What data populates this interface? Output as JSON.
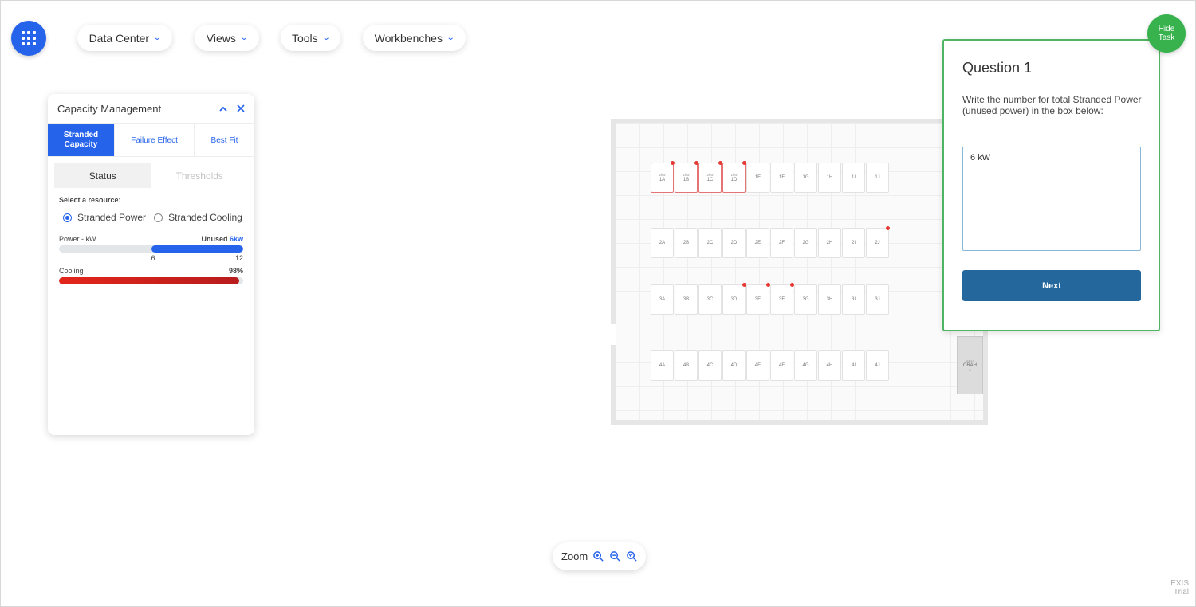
{
  "topbar": {
    "menus": [
      {
        "label": "Data Center"
      },
      {
        "label": "Views"
      },
      {
        "label": "Tools"
      },
      {
        "label": "Workbenches"
      }
    ]
  },
  "capacity_panel": {
    "title": "Capacity Management",
    "tabs": {
      "stranded_line1": "Stranded",
      "stranded_line2": "Capacity",
      "failure": "Failure Effect",
      "bestfit": "Best Fit"
    },
    "subtabs": {
      "status": "Status",
      "thresholds": "Thresholds"
    },
    "resource_label": "Select a resource:",
    "resources": {
      "power": "Stranded Power",
      "cooling": "Stranded Cooling"
    },
    "selected_resource": "Stranded Power",
    "power": {
      "label": "Power - kW",
      "unused_label": "Unused",
      "unused_value": "6kw",
      "tick_min": "6",
      "tick_max": "12",
      "used_kw": 6,
      "total_kw": 12
    },
    "cooling": {
      "label": "Cooling",
      "percent_label": "98%",
      "percent": 98
    }
  },
  "floor": {
    "racks": [
      {
        "id": "1A",
        "kw": "2kw",
        "alarm": true,
        "dot": true
      },
      {
        "id": "1B",
        "kw": "1kw",
        "alarm": true,
        "dot": true
      },
      {
        "id": "1C",
        "kw": "2kw",
        "alarm": true,
        "dot": true
      },
      {
        "id": "1D",
        "kw": "1kw",
        "alarm": true,
        "dot": true
      },
      {
        "id": "1E"
      },
      {
        "id": "1F"
      },
      {
        "id": "1G"
      },
      {
        "id": "1H"
      },
      {
        "id": "1I"
      },
      {
        "id": "1J"
      },
      {
        "id": "2A"
      },
      {
        "id": "2B"
      },
      {
        "id": "2C"
      },
      {
        "id": "2D"
      },
      {
        "id": "2E"
      },
      {
        "id": "2F"
      },
      {
        "id": "2G"
      },
      {
        "id": "2H"
      },
      {
        "id": "2I"
      },
      {
        "id": "2J",
        "dot": true
      },
      {
        "id": "3A"
      },
      {
        "id": "3B"
      },
      {
        "id": "3C"
      },
      {
        "id": "3D",
        "dot": true
      },
      {
        "id": "3E",
        "dot": true
      },
      {
        "id": "3F",
        "dot": true
      },
      {
        "id": "3G"
      },
      {
        "id": "3H"
      },
      {
        "id": "3I"
      },
      {
        "id": "3J"
      },
      {
        "id": "4A"
      },
      {
        "id": "4B"
      },
      {
        "id": "4C"
      },
      {
        "id": "4D"
      },
      {
        "id": "4E"
      },
      {
        "id": "4F"
      },
      {
        "id": "4G"
      },
      {
        "id": "4H"
      },
      {
        "id": "4I"
      },
      {
        "id": "4J"
      }
    ],
    "crah": {
      "top": "6PH",
      "name": "CRAH",
      "num": "1"
    }
  },
  "question": {
    "title": "Question 1",
    "text": "Write the number for total Stranded Power (unused power) in the box below:",
    "answer": "6 kW",
    "next_label": "Next"
  },
  "hide_task": {
    "line1": "Hide",
    "line2": "Task"
  },
  "zoom": {
    "label": "Zoom"
  },
  "watermark": {
    "line1": "EXIS",
    "line2": "Trial"
  },
  "colors": {
    "accent": "#2563eb",
    "alarm": "#e53935",
    "success": "#37b24d",
    "button": "#23679c"
  }
}
